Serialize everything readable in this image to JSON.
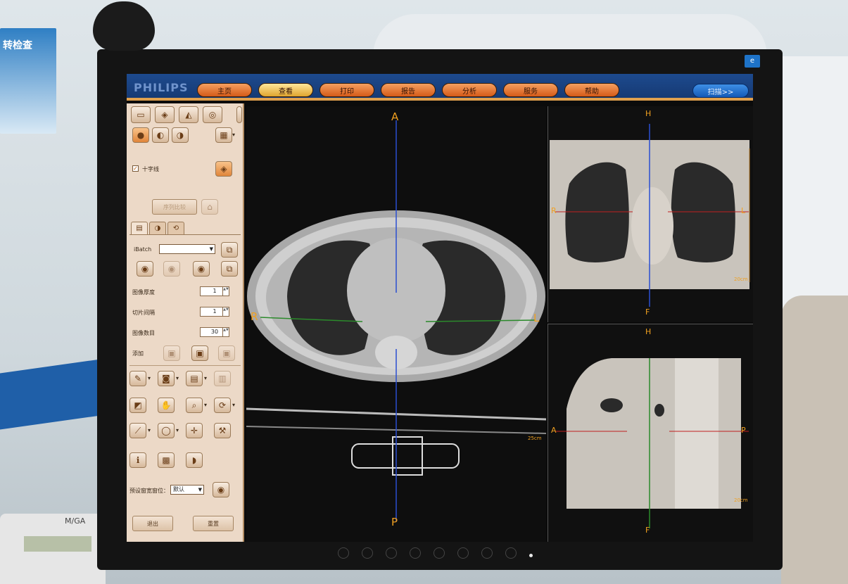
{
  "app": {
    "logo": "PHILIPS"
  },
  "menu": [
    {
      "label": "主页",
      "active": false
    },
    {
      "label": "查看",
      "active": true
    },
    {
      "label": "打印",
      "active": false
    },
    {
      "label": "报告",
      "active": false
    },
    {
      "label": "分析",
      "active": false
    },
    {
      "label": "服务",
      "active": false
    },
    {
      "label": "帮助",
      "active": false
    }
  ],
  "scan_button": "扫描>>",
  "left_panel": {
    "crosshair_label": "十字线",
    "crosshair_checked": true,
    "compare_button": "序列比较",
    "ibatch_label": "iBatch",
    "ibatch_value": "",
    "image_thickness_label": "图像厚度",
    "image_thickness_value": "1",
    "slice_spacing_label": "切片间隔",
    "slice_spacing_value": "1",
    "image_count_label": "图像数目",
    "image_count_value": "30",
    "add_label": "添加",
    "preset_label": "预设窗宽窗位：",
    "preset_value": "默认",
    "exit_button": "退出",
    "reset_button": "重置"
  },
  "viewports": {
    "axial": {
      "top": "A",
      "bottom": "P",
      "left": "R",
      "right": "L",
      "scale": "25cm"
    },
    "coronal": {
      "top": "H",
      "bottom": "F",
      "left": "R",
      "right": "L",
      "scale": "20cm"
    },
    "sagittal": {
      "top": "H",
      "bottom": "F",
      "left": "A",
      "right": "P",
      "scale": "20cm"
    }
  },
  "environment": {
    "phone_brand": "M/GA",
    "poster_text": "转检查"
  }
}
